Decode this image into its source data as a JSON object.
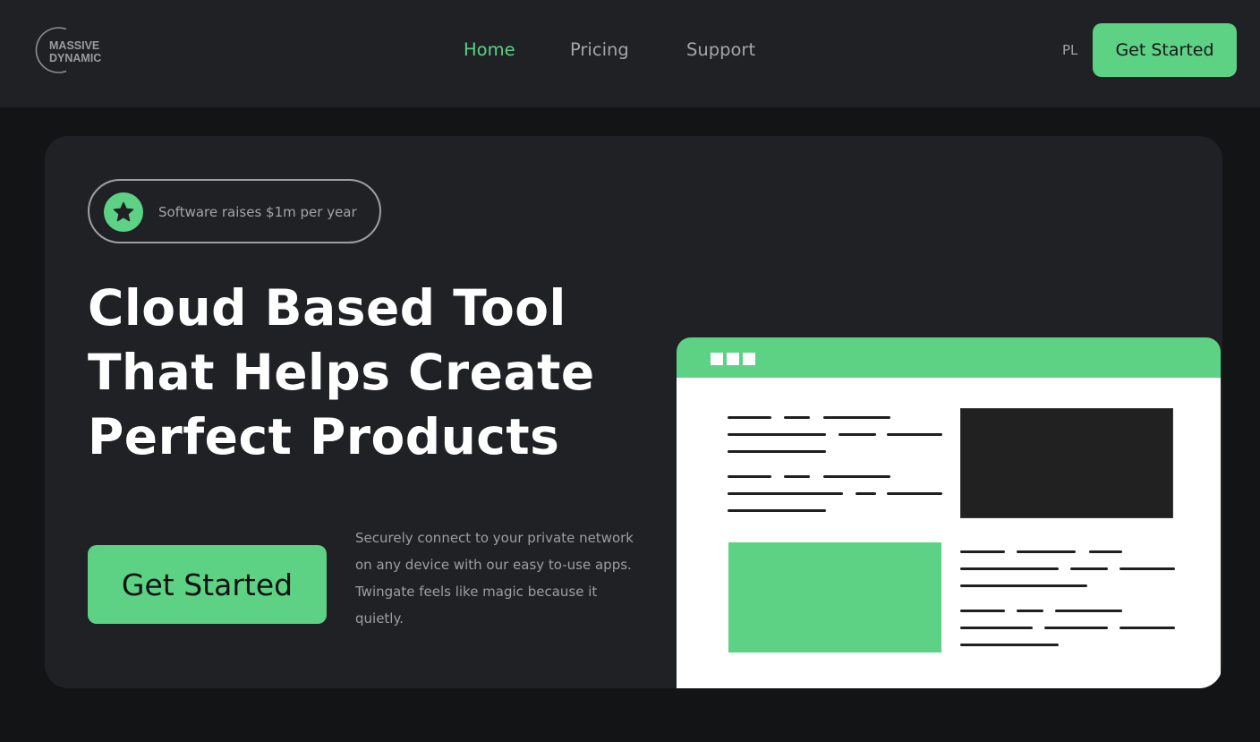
{
  "header": {
    "logo_text": "MASSIVE\nDYNAMIC",
    "nav": [
      "Home",
      "Pricing",
      "Support"
    ],
    "active_nav": "Home",
    "lang": "PL",
    "cta_label": "Get Started"
  },
  "hero": {
    "badge_icon": "star-icon",
    "badge_text": "Software raises $1m per year",
    "title_lines": [
      "Cloud Based Tool",
      "That Helps Create",
      "Perfect Products"
    ],
    "cta_label": "Get Started",
    "description": "Securely connect to your private network on any device with our easy to-use apps. Twingate feels like magic because it quietly."
  },
  "colors": {
    "accent": "#5dd184",
    "page_bg": "#131416",
    "surface": "#202125",
    "text": "#ffffff",
    "muted_text": "#a3a5aa"
  }
}
